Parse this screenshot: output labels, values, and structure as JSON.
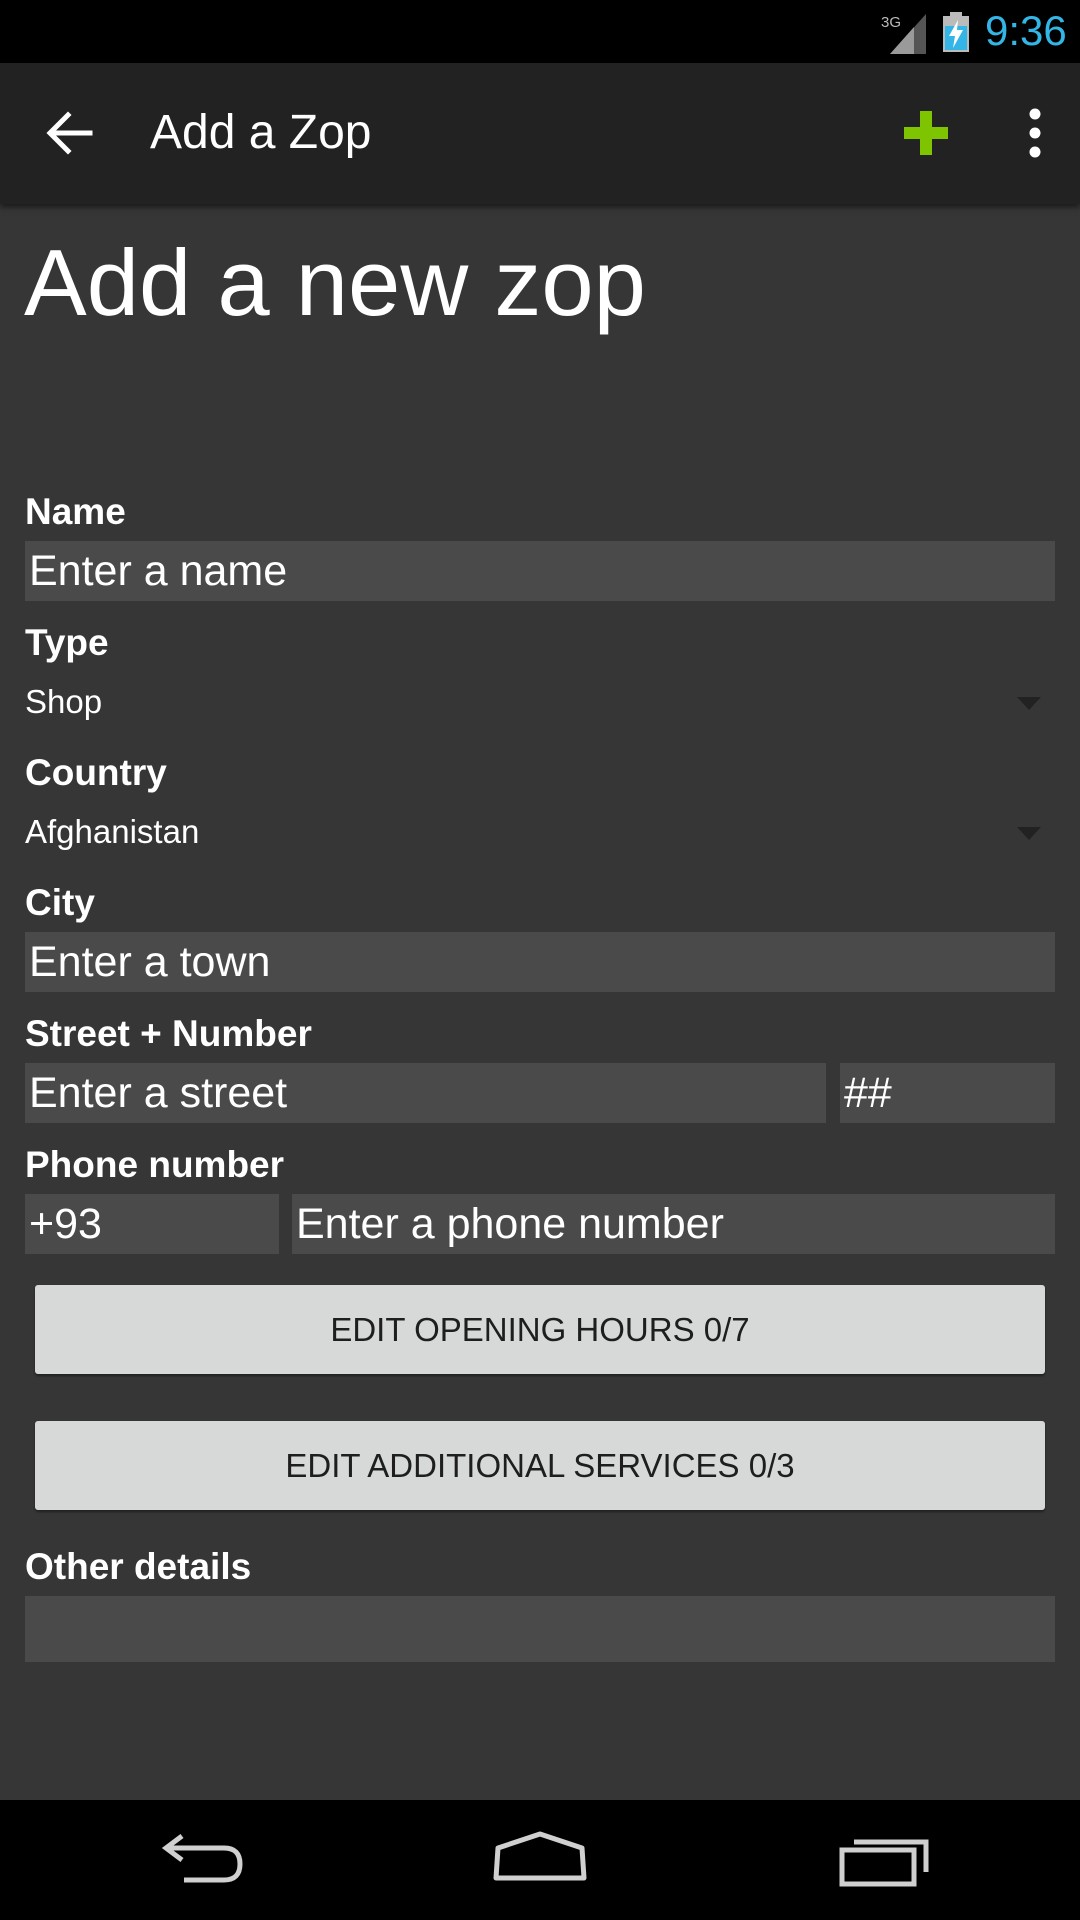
{
  "status_bar": {
    "network_type": "3G",
    "time": "9:36",
    "accent_color": "#33b5e5"
  },
  "action_bar": {
    "back_icon": "arrow-back-icon",
    "title": "Add a Zop",
    "add_icon": "plus-icon",
    "add_color": "#7fc400",
    "overflow_icon": "more-vertical-icon"
  },
  "form": {
    "heading": "Add a new zop",
    "name": {
      "label": "Name",
      "placeholder": "Enter a name"
    },
    "type": {
      "label": "Type",
      "value": "Shop"
    },
    "country": {
      "label": "Country",
      "value": "Afghanistan"
    },
    "city": {
      "label": "City",
      "placeholder": "Enter a town"
    },
    "street": {
      "label": "Street + Number",
      "street_placeholder": "Enter a street",
      "number_placeholder": "##"
    },
    "phone": {
      "label": "Phone number",
      "prefix": "+93",
      "placeholder": "Enter a phone number"
    },
    "opening_hours_button": "EDIT OPENING HOURS 0/7",
    "services_button": "EDIT ADDITIONAL SERVICES 0/3",
    "other": {
      "label": "Other details",
      "value": ""
    }
  },
  "nav_bar": {
    "back_icon": "nav-back-icon",
    "home_icon": "nav-home-icon",
    "recents_icon": "nav-recents-icon"
  }
}
